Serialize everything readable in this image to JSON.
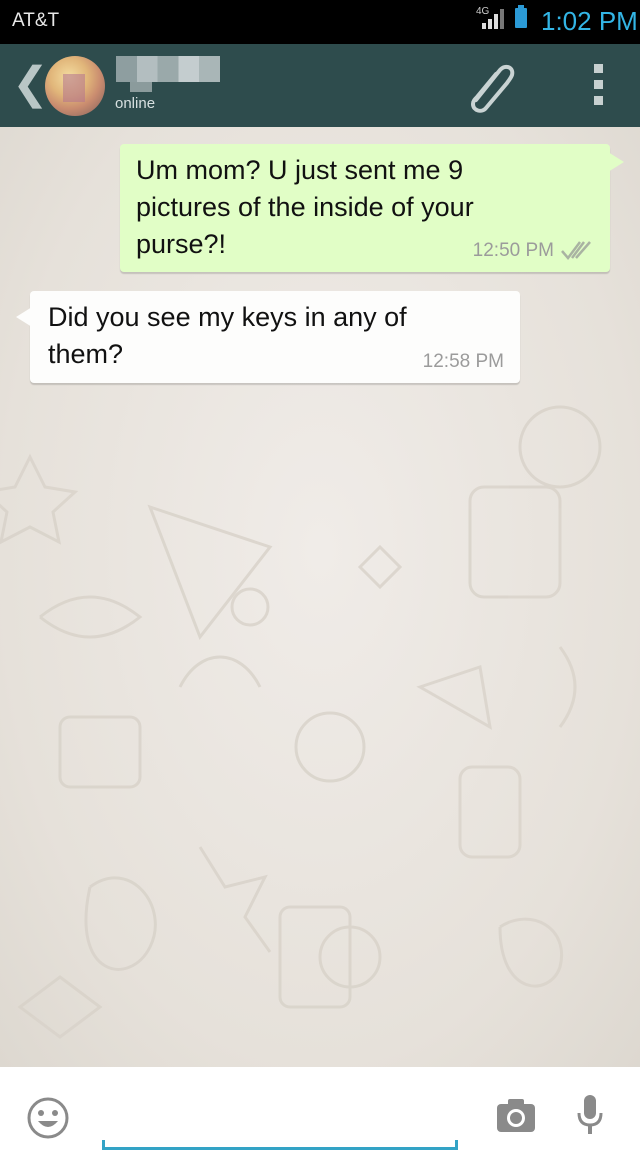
{
  "status_bar": {
    "carrier": "AT&T",
    "network": "4G",
    "time": "1:02 PM"
  },
  "header": {
    "back_icon": "chevron-left-icon",
    "presence": "online",
    "attach_icon": "paperclip-icon",
    "menu_icon": "overflow-menu-icon",
    "color": "#2e4c4d"
  },
  "messages": [
    {
      "direction": "outgoing",
      "text": "Um mom? U just sent me 9 pictures of the inside of your purse?!",
      "time": "12:50 PM",
      "status": "read",
      "bubble_color": "#e1fec6"
    },
    {
      "direction": "incoming",
      "text": "Did you see my keys in any of them?",
      "time": "12:58 PM",
      "bubble_color": "#fdfdfc"
    }
  ],
  "input_bar": {
    "emoji_icon": "smiley-icon",
    "camera_icon": "camera-icon",
    "mic_icon": "microphone-icon",
    "accent": "#33a3c6"
  }
}
